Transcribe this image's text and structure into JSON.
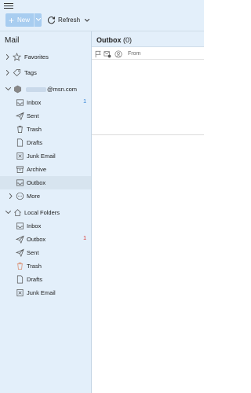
{
  "toolbar": {
    "new_label": "New",
    "refresh_label": "Refresh"
  },
  "sidebar": {
    "title": "Mail",
    "favorites": "Favorites",
    "tags": "Tags",
    "account": {
      "email_suffix": "@msn.com",
      "folders": [
        {
          "label": "Inbox",
          "count": "1",
          "icon": "inbox-icon"
        },
        {
          "label": "Sent",
          "count": "",
          "icon": "sent-icon"
        },
        {
          "label": "Trash",
          "count": "",
          "icon": "trash-icon"
        },
        {
          "label": "Drafts",
          "count": "",
          "icon": "drafts-icon"
        },
        {
          "label": "Junk Email",
          "count": "",
          "icon": "junk-icon"
        },
        {
          "label": "Archive",
          "count": "",
          "icon": "archive-icon"
        },
        {
          "label": "Outbox",
          "count": "",
          "icon": "outbox-icon",
          "selected": true
        }
      ],
      "more": "More"
    },
    "local": {
      "title": "Local Folders",
      "folders": [
        {
          "label": "Inbox",
          "count": "",
          "icon": "inbox-icon"
        },
        {
          "label": "Outbox",
          "count": "1",
          "icon": "outbox-icon"
        },
        {
          "label": "Sent",
          "count": "",
          "icon": "sent-icon"
        },
        {
          "label": "Trash",
          "count": "",
          "icon": "trash-icon"
        },
        {
          "label": "Drafts",
          "count": "",
          "icon": "drafts-icon"
        },
        {
          "label": "Junk Email",
          "count": "",
          "icon": "junk-icon"
        }
      ]
    }
  },
  "main": {
    "folder_name": "Outbox",
    "folder_count": "(0)",
    "columns": {
      "from": "From"
    }
  },
  "colors": {
    "accent": "#a8cdf0",
    "panel_bg": "#e3effa",
    "selected_bg": "#d7e4ef",
    "count_blue": "#2a7fd4",
    "count_red": "#d9302c"
  }
}
